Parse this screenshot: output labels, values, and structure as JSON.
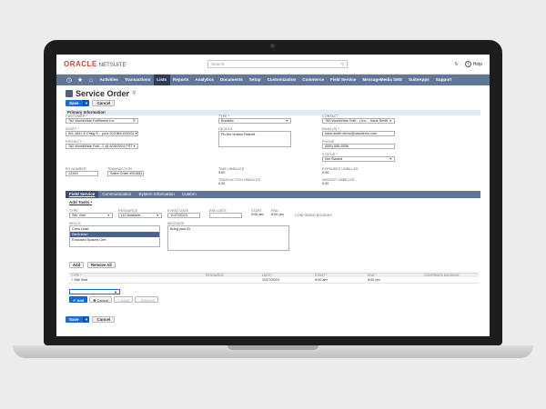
{
  "app": {
    "logo_oracle": "ORACLE",
    "logo_netsuite": "NETSUITE",
    "search_placeholder": "Search",
    "recent_label": "",
    "help_label": "Help"
  },
  "nav": {
    "items": [
      "Activities",
      "Transactions",
      "Lists",
      "Reports",
      "Analytics",
      "Documents",
      "Setup",
      "Customization",
      "Commerce",
      "Field Service",
      "MessageMedia SMS",
      "SuiteApps",
      "Support"
    ],
    "active_index": 2
  },
  "page": {
    "title": "Service Order",
    "save_label": "Save",
    "cancel_label": "Cancel",
    "primary_info_label": "Primary Information"
  },
  "fields": {
    "customer": {
      "label": "CUSTOMER *",
      "value": "782 WorldWide Fulfillment Inc."
    },
    "asset": {
      "label": "ASSET *",
      "value": "WL-1841 E Craig R... ps/a 202384/1000/01"
    },
    "project": {
      "label": "PROJECT *",
      "value": "782 WorldWide Fulfi...2 @ 8/28/2024 PST"
    },
    "type": {
      "label": "TYPE *",
      "value": "Breakfix"
    },
    "details": {
      "label": "DETAILS",
      "value": "Fix the broken Retrofit"
    },
    "contact": {
      "label": "CONTACT",
      "value": "782 WorldWide Fulfi... | Inc. : Hank Smith"
    },
    "email": {
      "label": "EMAIL(S) *",
      "value": "hank.smith.demo@nswdemo.com"
    },
    "phone": {
      "label": "PHONE",
      "value": "(555) 555-5556"
    },
    "status": {
      "label": "STATUS *",
      "value": "Not Started"
    },
    "po_number": {
      "label": "PO NUMBER",
      "value": "12345"
    },
    "transaction": {
      "label": "TRANSACTION",
      "value": "Sales Order #SO654"
    },
    "time_unbilled": {
      "label": "TIME UNBILLED",
      "value": "0.00"
    },
    "transaction_unbilled": {
      "label": "TRANSACTION UNBILLED",
      "value": "0.00"
    },
    "expenses_unbilled": {
      "label": "EXPENSES UNBILLED",
      "value": "0.00"
    },
    "amount_unbilled": {
      "label": "AMOUNT UNBILLED",
      "value": "0.00"
    }
  },
  "tabs": [
    "Field Service",
    "Communication",
    "System Information",
    "Custom"
  ],
  "active_tab": 0,
  "subtab": "Add Tasks •",
  "task_form": {
    "type": {
      "label": "TYPE",
      "value": "Site Visit"
    },
    "resource": {
      "label": "RESOURCE",
      "value": "(12 available..."
    },
    "event_date": {
      "label": "EVENT DATE",
      "value": "11/27/2023"
    },
    "end_date": {
      "label": "END DATE",
      "value": ""
    },
    "start": {
      "label": "START",
      "value": "9:00 am"
    },
    "end": {
      "label": "END",
      "value": "5:00 pm"
    },
    "confirmed_booking": {
      "label": "CONFIRMED BOOKING"
    },
    "skills": {
      "label": "SKILLS",
      "options": [
        "Crew Lead",
        "Electrician",
        "Enclosed Spaces Cert"
      ],
      "selected_index": 1
    },
    "message": {
      "label": "MESSAGE",
      "value": "Bring your ID"
    },
    "add_label": "Add",
    "remove_all_label": "Remove All"
  },
  "grid": {
    "headers": [
      "TYPE *",
      "RESOURCE",
      "DATE *",
      "START *",
      "END *",
      "CONFIRMED BOOKING"
    ],
    "rows": [
      [
        "+ Site Visit",
        "",
        "11/27/2023",
        "9:00 am",
        "5:00 pm",
        ""
      ]
    ]
  },
  "line_buttons": {
    "add": "✔ Add",
    "cancel": "✖ Cancel",
    "insert": "+ Insert",
    "remove": "- Remove"
  },
  "footer": {
    "save_label": "Save",
    "cancel_label": "Cancel"
  }
}
